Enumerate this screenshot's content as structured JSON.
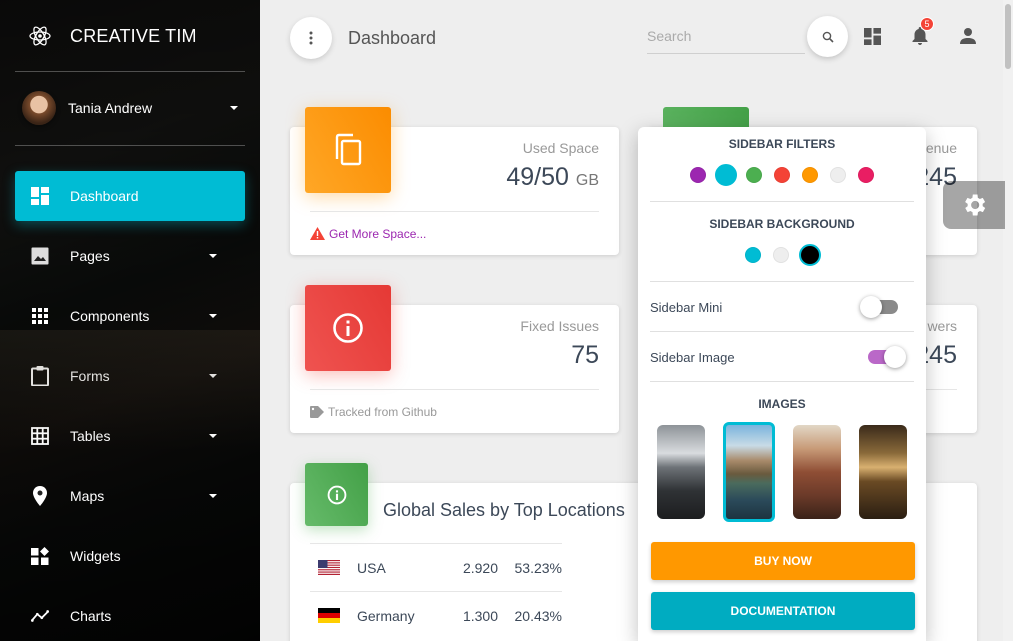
{
  "brand": {
    "name": "CREATIVE TIM",
    "icon": "react-atom-icon"
  },
  "user": {
    "name": "Tania Andrew"
  },
  "sidebar": {
    "items": [
      {
        "label": "Dashboard",
        "icon": "dashboard-icon",
        "active": true,
        "has_caret": false
      },
      {
        "label": "Pages",
        "icon": "image-icon",
        "has_caret": true
      },
      {
        "label": "Components",
        "icon": "apps-grid-icon",
        "has_caret": true
      },
      {
        "label": "Forms",
        "icon": "clipboard-icon",
        "has_caret": true
      },
      {
        "label": "Tables",
        "icon": "grid-table-icon",
        "has_caret": true
      },
      {
        "label": "Maps",
        "icon": "place-icon",
        "has_caret": true
      },
      {
        "label": "Widgets",
        "icon": "widgets-icon",
        "has_caret": false
      },
      {
        "label": "Charts",
        "icon": "timeline-icon",
        "has_caret": false
      }
    ]
  },
  "header": {
    "title": "Dashboard",
    "search_placeholder": "Search",
    "notification_count": "5"
  },
  "cards": {
    "used_space": {
      "category": "Used Space",
      "value": "49/50",
      "unit": "GB",
      "footer": "Get More Space...",
      "color": "#ff9800"
    },
    "fixed_issues": {
      "category": "Fixed Issues",
      "value": "75",
      "footer": "Tracked from Github",
      "color": "#f44336"
    },
    "revenue": {
      "category_partial": "enue",
      "value_partial": "245",
      "color": "#4caf50"
    },
    "followers": {
      "category_partial": "wers",
      "value_partial": "245"
    }
  },
  "global_sales": {
    "title": "Global Sales by Top Locations",
    "rows": [
      {
        "country": "USA",
        "amount": "2.920",
        "percent": "53.23%"
      },
      {
        "country": "Germany",
        "amount": "1.300",
        "percent": "20.43%"
      }
    ]
  },
  "plugin": {
    "filters_title": "SIDEBAR FILTERS",
    "filter_colors": [
      "#9c27b0",
      "#00bcd4",
      "#4caf50",
      "#f44336",
      "#ff9800",
      "#eeeeee",
      "#e91e63"
    ],
    "background_title": "SIDEBAR BACKGROUND",
    "background_colors": [
      "#00bcd4",
      "#eeeeee",
      "#000000"
    ],
    "sidebar_mini_label": "Sidebar Mini",
    "sidebar_mini_on": false,
    "sidebar_image_label": "Sidebar Image",
    "sidebar_image_on": true,
    "images_title": "IMAGES",
    "buy_now": "BUY NOW",
    "documentation": "DOCUMENTATION"
  }
}
